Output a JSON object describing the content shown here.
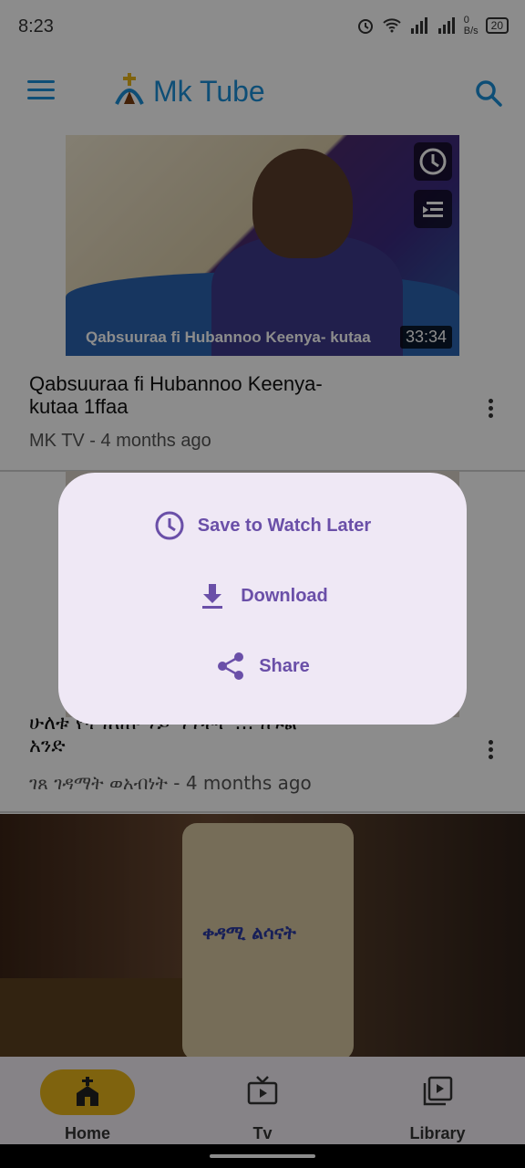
{
  "status_bar": {
    "time": "8:23",
    "net_speed": "0\nB/s",
    "battery": "20"
  },
  "app_bar": {
    "title": "Mk Tube"
  },
  "videos": [
    {
      "thumb_caption": "Qabsuuraa fi Hubannoo Keenya- kutaa",
      "duration": "33:34",
      "title": "Qabsuuraa fi Hubannoo Keenya-\nkutaa 1ffaa",
      "meta": "MK TV - 4 months ago"
    },
    {
      "title": "ሁለቱ የተገለጡ ሃይማኖቶች ... ክፍል\nአንድ",
      "meta": "ገጸ ገዳማት ወአብነት - 4 months ago"
    }
  ],
  "banner": {
    "text": "ቀዳሚ ልሳናት"
  },
  "sheet": {
    "items": [
      {
        "label": "Save to Watch Later",
        "icon": "clock-icon"
      },
      {
        "label": "Download",
        "icon": "download-icon"
      },
      {
        "label": "Share",
        "icon": "share-icon"
      }
    ]
  },
  "bottom_nav": {
    "items": [
      {
        "label": "Home",
        "active": true
      },
      {
        "label": "Tv",
        "active": false
      },
      {
        "label": "Library",
        "active": false
      }
    ]
  },
  "colors": {
    "brand": "#1a8ed8",
    "accent": "#6a4fa8",
    "active_pill": "#e7b41a"
  }
}
